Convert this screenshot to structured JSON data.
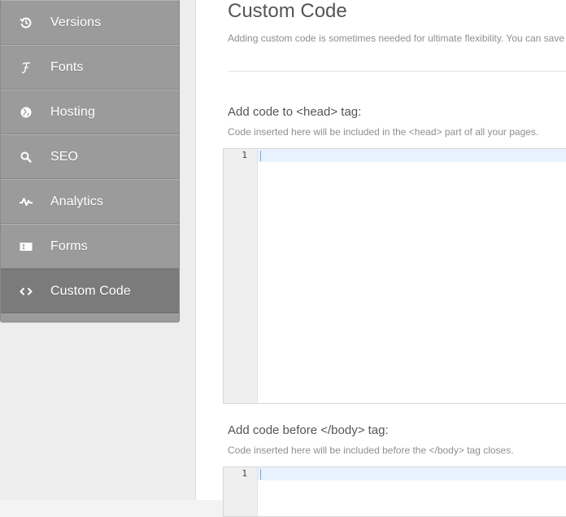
{
  "sidebar": {
    "items": [
      {
        "label": "Versions",
        "icon": "history-icon",
        "active": false
      },
      {
        "label": "Fonts",
        "icon": "font-icon",
        "active": false
      },
      {
        "label": "Hosting",
        "icon": "globe-icon",
        "active": false
      },
      {
        "label": "SEO",
        "icon": "search-icon",
        "active": false
      },
      {
        "label": "Analytics",
        "icon": "pulse-icon",
        "active": false
      },
      {
        "label": "Forms",
        "icon": "form-icon",
        "active": false
      },
      {
        "label": "Custom Code",
        "icon": "code-icon",
        "active": true
      }
    ]
  },
  "main": {
    "title": "Custom Code",
    "description": "Adding custom code is sometimes needed for ultimate flexibility. You can save",
    "head_section": {
      "title": "Add code to <head> tag:",
      "description": "Code inserted here will be included in the <head> part of all your pages.",
      "line_number": "1",
      "value": ""
    },
    "body_section": {
      "title": "Add code before </body> tag:",
      "description": "Code inserted here will be included before the </body> tag closes.",
      "line_number": "1",
      "value": ""
    }
  },
  "colors": {
    "sidebar_bg": "#9b9b9b",
    "sidebar_active_bg": "#7b7b7b",
    "active_line": "#e8f2fe"
  }
}
